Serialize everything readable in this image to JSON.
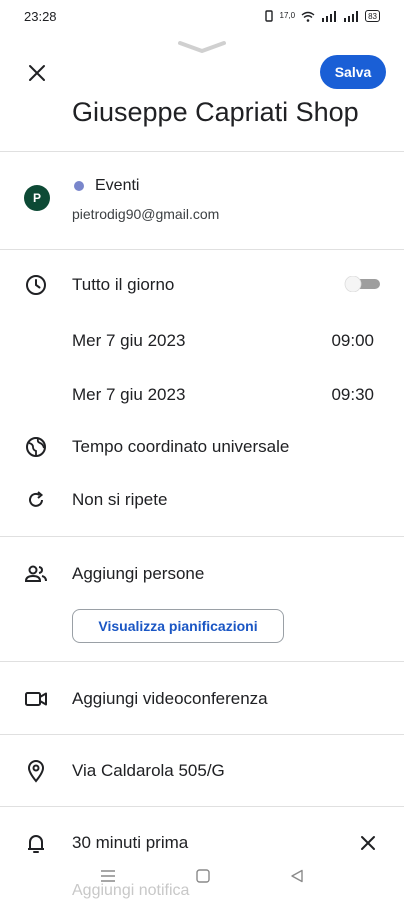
{
  "status": {
    "time": "23:28",
    "net": "17,0",
    "battery": "83"
  },
  "header": {
    "save_label": "Salva",
    "title": "Giuseppe Capriati Shop"
  },
  "calendar": {
    "avatar_letter": "P",
    "name": "Eventi",
    "email": "pietrodig90@gmail.com",
    "color": "#7986cb"
  },
  "time": {
    "all_day_label": "Tutto il giorno",
    "start_date": "Mer 7 giu 2023",
    "start_time": "09:00",
    "end_date": "Mer 7 giu 2023",
    "end_time": "09:30",
    "timezone": "Tempo coordinato universale",
    "repeat": "Non si ripete"
  },
  "people": {
    "label": "Aggiungi persone",
    "schedule_button": "Visualizza pianificazioni"
  },
  "video": {
    "label": "Aggiungi videoconferenza"
  },
  "location": {
    "label": "Via Caldarola 505/G"
  },
  "notification": {
    "label": "30 minuti prima",
    "add_label": "Aggiungi notifica"
  },
  "colors": {
    "accent": "#1a5fd6",
    "avatar": "#0d4a35"
  }
}
